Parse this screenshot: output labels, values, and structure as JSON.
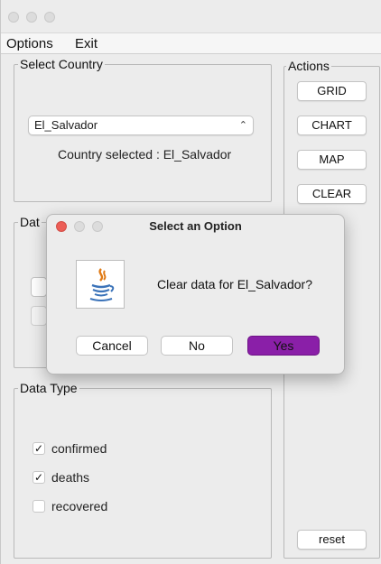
{
  "menu": {
    "options": "Options",
    "exit": "Exit"
  },
  "select_country": {
    "title": "Select Country",
    "selected_value": "El_Salvador",
    "status_text": "Country selected : El_Salvador"
  },
  "data_group": {
    "title_visible": "Dat"
  },
  "actions": {
    "title": "Actions",
    "grid": "GRID",
    "chart": "CHART",
    "map": "MAP",
    "clear": "CLEAR",
    "reset": "reset"
  },
  "data_type": {
    "title": "Data Type",
    "items": [
      {
        "label": "confirmed",
        "checked": true
      },
      {
        "label": "deaths",
        "checked": true
      },
      {
        "label": "recovered",
        "checked": false
      }
    ]
  },
  "dialog": {
    "title": "Select an Option",
    "message": "Clear data for El_Salvador?",
    "buttons": {
      "cancel": "Cancel",
      "no": "No",
      "yes": "Yes"
    }
  },
  "colors": {
    "accent": "#8a1fa8",
    "close_dot": "#ec5e57"
  }
}
